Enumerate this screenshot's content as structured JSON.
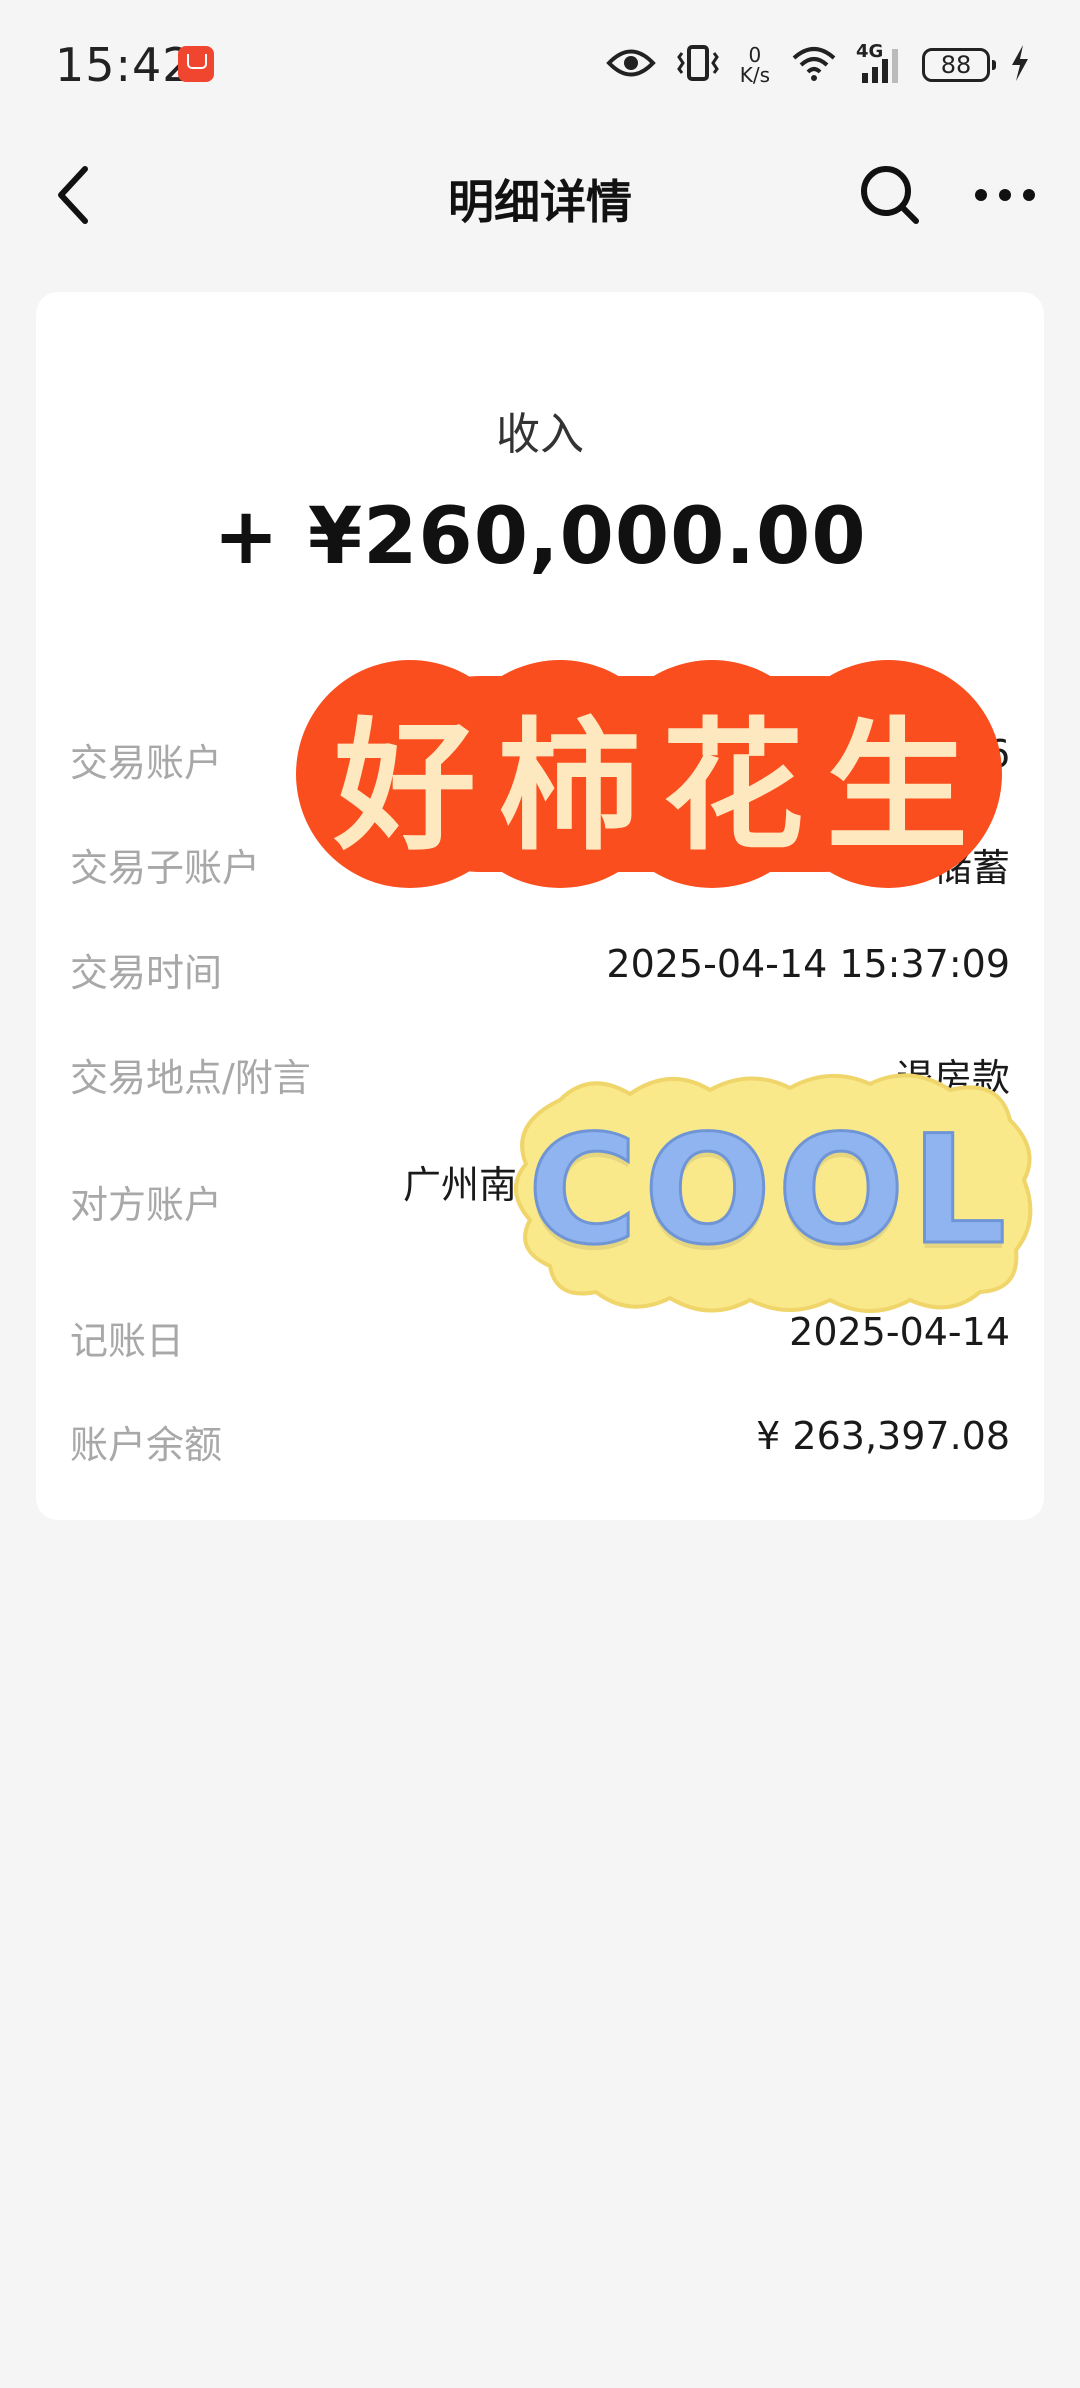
{
  "status_bar": {
    "time": "15:42",
    "net_speed_value": "0",
    "net_speed_unit": "K/s",
    "signal_type": "4G",
    "battery_level": "88"
  },
  "nav": {
    "title": "明细详情"
  },
  "transaction": {
    "type_label": "收入",
    "amount": "+ ¥260,000.00"
  },
  "details": {
    "account_label": "交易账户",
    "account_value": "6",
    "sub_account_label": "交易子账户",
    "sub_account_value": "储蓄",
    "time_label": "交易时间",
    "time_value": "2025-04-14 15:37:09",
    "location_label": "交易地点/附言",
    "location_value": "退房款",
    "counterparty_label": "对方账户",
    "counterparty_value": "广州南沙",
    "posting_date_label": "记账日",
    "posting_date_value": "2025-04-14",
    "balance_label": "账户余额",
    "balance_value": "¥ 263,397.08"
  },
  "stickers": {
    "peanut_text": "好柿花生",
    "cool_text": "COOL"
  },
  "colors": {
    "background": "#f5f5f5",
    "card": "#ffffff",
    "label": "#a8a8a8",
    "sticker_orange": "#fb4e1e",
    "sticker_cream": "#fde8c0",
    "sticker_yellow": "#f9e98a"
  }
}
